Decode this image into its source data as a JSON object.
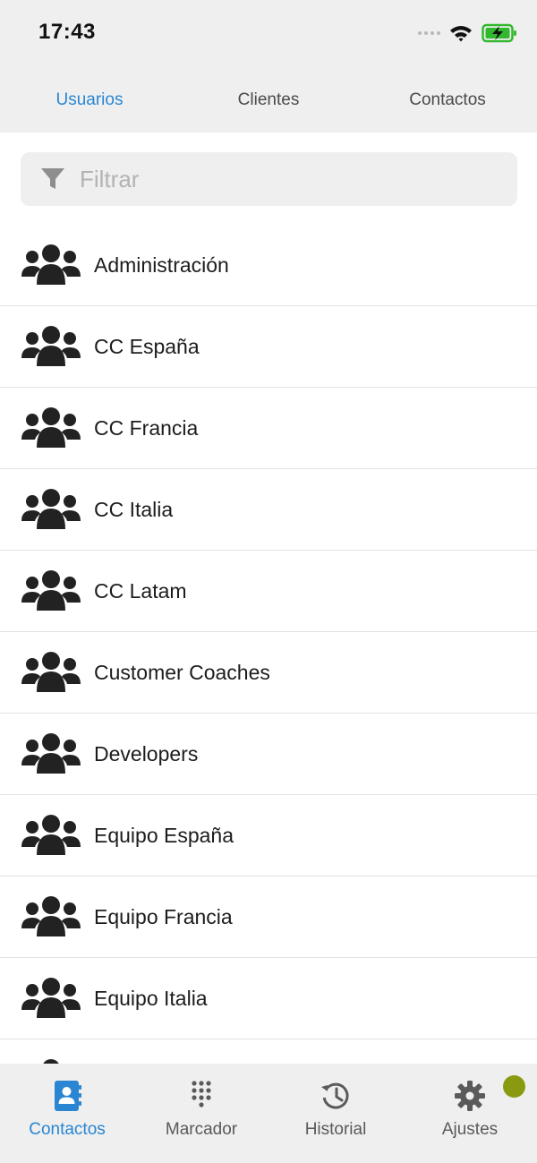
{
  "status_bar": {
    "time": "17:43"
  },
  "top_tabs": [
    {
      "label": "Usuarios",
      "active": true
    },
    {
      "label": "Clientes",
      "active": false
    },
    {
      "label": "Contactos",
      "active": false
    }
  ],
  "filter": {
    "placeholder": "Filtrar",
    "value": "",
    "icon": "filter-icon"
  },
  "groups": [
    {
      "label": "Administración",
      "icon": "users-group-icon"
    },
    {
      "label": "CC España",
      "icon": "users-group-icon"
    },
    {
      "label": "CC Francia",
      "icon": "users-group-icon"
    },
    {
      "label": "CC Italia",
      "icon": "users-group-icon"
    },
    {
      "label": "CC Latam",
      "icon": "users-group-icon"
    },
    {
      "label": "Customer Coaches",
      "icon": "users-group-icon"
    },
    {
      "label": "Developers",
      "icon": "users-group-icon"
    },
    {
      "label": "Equipo España",
      "icon": "users-group-icon"
    },
    {
      "label": "Equipo Francia",
      "icon": "users-group-icon"
    },
    {
      "label": "Equipo Italia",
      "icon": "users-group-icon"
    },
    {
      "label": "",
      "icon": "users-group-icon"
    }
  ],
  "tab_bar": [
    {
      "label": "Contactos",
      "icon": "contacts-book-icon",
      "active": true
    },
    {
      "label": "Marcador",
      "icon": "dialpad-icon",
      "active": false
    },
    {
      "label": "Historial",
      "icon": "history-icon",
      "active": false
    },
    {
      "label": "Ajustes",
      "icon": "gear-icon",
      "active": false
    }
  ],
  "colors": {
    "accent": "#2a86d2",
    "bar_background": "#efefef",
    "notification_dot": "#8a9a10"
  }
}
